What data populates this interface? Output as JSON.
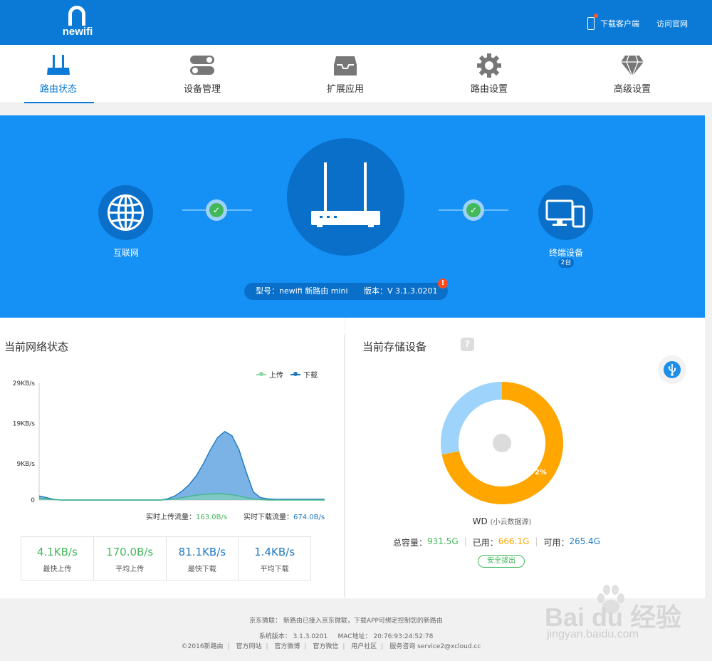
{
  "header": {
    "logo_text": "newifi",
    "download_client": "下载客户端",
    "visit_site": "访问官网"
  },
  "nav": [
    {
      "label": "路由状态",
      "icon": "router-icon",
      "active": true
    },
    {
      "label": "设备管理",
      "icon": "toggle-icon",
      "active": false
    },
    {
      "label": "扩展应用",
      "icon": "tray-icon",
      "active": false
    },
    {
      "label": "路由设置",
      "icon": "gear-icon",
      "active": false
    },
    {
      "label": "高级设置",
      "icon": "diamond-icon",
      "active": false
    }
  ],
  "topology": {
    "internet_label": "互联网",
    "devices_label": "终端设备",
    "devices_count": "2台",
    "model_text": "型号：newifi 新路由 mini",
    "version_text": "版本：V 3.1.3.0201",
    "alert": "!"
  },
  "network": {
    "title": "当前网络状态",
    "legend_upload": "上传",
    "legend_download": "下载",
    "realtime_upload_label": "实时上传流量：",
    "realtime_upload_value": "163.0B/s",
    "realtime_download_label": "实时下载流量：",
    "realtime_download_value": "674.0B/s",
    "stats": [
      {
        "value": "4.1KB/s",
        "label": "最快上传",
        "color": "#43b85b"
      },
      {
        "value": "170.0B/s",
        "label": "平均上传",
        "color": "#43b85b"
      },
      {
        "value": "81.1KB/s",
        "label": "最快下载",
        "color": "#1f78c1"
      },
      {
        "value": "1.4KB/s",
        "label": "平均下载",
        "color": "#1f78c1"
      }
    ]
  },
  "chart_data": {
    "type": "area",
    "yticks": [
      "29KB/s",
      "19KB/s",
      "9KB/s",
      "0"
    ],
    "ylim": [
      0,
      29
    ],
    "x": [
      0,
      1,
      2,
      3,
      4,
      5,
      6,
      7,
      8,
      9,
      10,
      11,
      12,
      13,
      14,
      15,
      16,
      17,
      18,
      19,
      20,
      21,
      22,
      23,
      24,
      25,
      26,
      27,
      28,
      29,
      30,
      31,
      32,
      33,
      34,
      35,
      36,
      37,
      38,
      39,
      40
    ],
    "series": [
      {
        "name": "上传",
        "color": "#43b88a",
        "values": [
          0.5,
          0.3,
          0.1,
          0,
          0,
          0,
          0,
          0,
          0,
          0,
          0,
          0,
          0,
          0,
          0,
          0,
          0,
          0,
          0.1,
          0.3,
          0.6,
          0.9,
          1.2,
          1.4,
          1.5,
          1.6,
          1.5,
          1.3,
          1.0,
          0.6,
          0.3,
          0.1,
          0,
          0,
          0,
          0,
          0,
          0,
          0,
          0,
          0
        ]
      },
      {
        "name": "下载",
        "color": "#1f78c1",
        "values": [
          1.0,
          0.6,
          0.2,
          0,
          0,
          0,
          0,
          0,
          0,
          0,
          0,
          0,
          0,
          0,
          0,
          0,
          0,
          0,
          0.3,
          1.0,
          2.2,
          3.8,
          6.0,
          9.0,
          12.5,
          15.5,
          17.0,
          16.0,
          12.5,
          7.0,
          2.0,
          0.6,
          0.3,
          0.2,
          0.2,
          0.2,
          0.2,
          0.2,
          0.2,
          0.2,
          0.2
        ]
      }
    ]
  },
  "storage": {
    "title": "当前存储设备",
    "help": "?",
    "disk_name": "WD",
    "disk_source": "(小云数据源)",
    "used_percent_label": "72%",
    "used_fraction": 0.72,
    "total_label": "总容量：",
    "total_value": "931.5G",
    "used_label": "已用：",
    "used_value": "666.1G",
    "free_label": "可用：",
    "free_value": "265.4G",
    "eject_label": "安全拔出",
    "colors": {
      "used": "#ffa600",
      "free": "#9ed4fb",
      "total": "#43b85b",
      "free_text": "#1f78c1"
    }
  },
  "footer": {
    "jd_line": "京东微联： 新路由已接入京东微联，下载APP可绑定控制您的新路由",
    "system_line": "系统版本： 3.1.3.0201     MAC地址： 20:76:93:24:52:78",
    "copyright": "©2016新路由",
    "links": [
      "官方网站",
      "官方微博",
      "官方微信",
      "用户社区",
      "服务咨询 service2@xcloud.cc"
    ]
  },
  "watermark": {
    "text": "Bai du 经验",
    "sub": "jingyan.baidu.com"
  }
}
